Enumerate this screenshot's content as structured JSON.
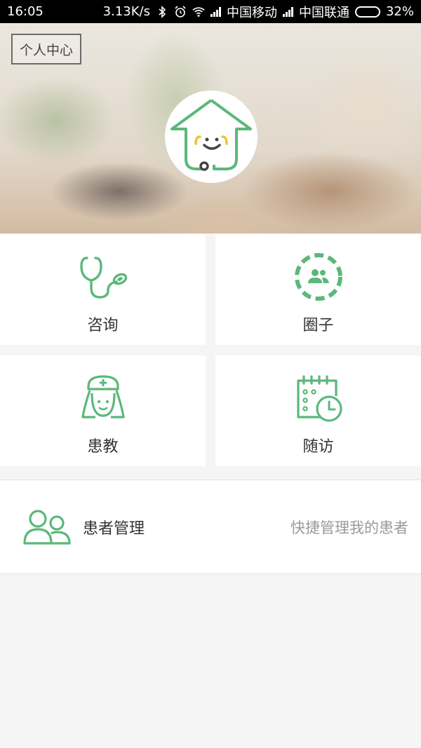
{
  "status_bar": {
    "time": "16:05",
    "speed": "3.13K/s",
    "carrier1": "中国移动",
    "carrier2": "中国联通",
    "battery": "32%",
    "battery_level": 0.32
  },
  "header": {
    "personal_center": "个人中心"
  },
  "grid": [
    {
      "label": "咨询",
      "icon": "stethoscope-icon"
    },
    {
      "label": "圈子",
      "icon": "circle-group-icon"
    },
    {
      "label": "患教",
      "icon": "nurse-icon"
    },
    {
      "label": "随访",
      "icon": "calendar-clock-icon"
    }
  ],
  "patient_mgmt": {
    "title": "患者管理",
    "desc": "快捷管理我的患者",
    "icon": "users-icon"
  },
  "colors": {
    "accent": "#5bb87a",
    "text": "#333333",
    "muted": "#9a9a9a",
    "background": "#f5f5f5"
  }
}
